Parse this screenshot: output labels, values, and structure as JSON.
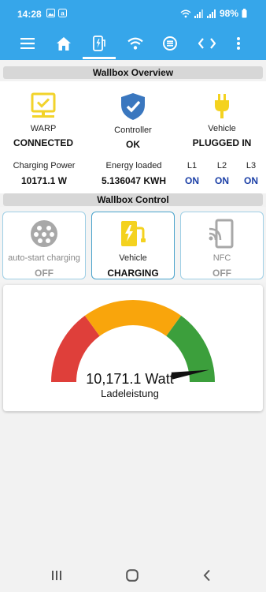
{
  "status_bar": {
    "time": "14:28",
    "battery": "98%"
  },
  "app_bar": {
    "nav_items": [
      "menu-icon",
      "home-icon",
      "wallbox-icon",
      "wifi-icon",
      "ethernet-icon",
      "code-icon",
      "more-vert-icon"
    ],
    "active_index": 2,
    "accent_color": "#36a6ea"
  },
  "overview": {
    "title": "Wallbox Overview",
    "status": [
      {
        "icon": "warp-monitor-icon",
        "label": "WARP",
        "value": "CONNECTED",
        "color": "#f2d32a"
      },
      {
        "icon": "shield-check-icon",
        "label": "Controller",
        "value": "OK",
        "color": "#3a77bf"
      },
      {
        "icon": "plug-icon",
        "label": "Vehicle",
        "value": "PLUGGED IN",
        "color": "#f4d21f"
      }
    ],
    "charging_power": {
      "label": "Charging Power",
      "value": "10171.1 W"
    },
    "energy_loaded": {
      "label": "Energy loaded",
      "value": "5.136047 KWH"
    },
    "phases": [
      {
        "label": "L1",
        "value": "ON"
      },
      {
        "label": "L2",
        "value": "ON"
      },
      {
        "label": "L3",
        "value": "ON"
      }
    ]
  },
  "control": {
    "title": "Wallbox Control",
    "cards": [
      {
        "icon": "type2-connector-icon",
        "label": "auto-start charging",
        "value": "OFF",
        "active": false
      },
      {
        "icon": "charging-station-icon",
        "label": "Vehicle",
        "value": "CHARGING",
        "active": true
      },
      {
        "icon": "nfc-phone-icon",
        "label": "NFC",
        "value": "OFF",
        "active": false
      }
    ]
  },
  "gauge": {
    "value_text": "10,171.1 Watt",
    "caption": "Ladeleistung",
    "needle_fraction": 0.95,
    "colors": {
      "red": "#df3f3a",
      "orange": "#f9a50c",
      "green": "#3c9f3c"
    }
  }
}
